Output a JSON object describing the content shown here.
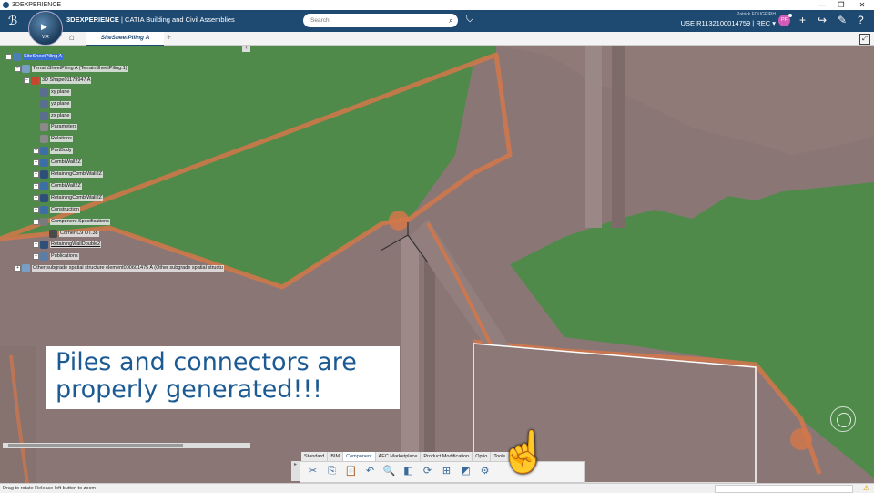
{
  "window": {
    "title": "3DEXPERIENCE",
    "controls": [
      "—",
      "❐",
      "✕"
    ]
  },
  "topbar": {
    "brand_bold": "3DEXPERIENCE",
    "brand_rest": " | CATIA Building and Civil Assemblies",
    "search_placeholder": "Search",
    "user_name": "Patrick FOUGEIRH",
    "context": "USE R1132100014759 | REC ▾",
    "avatar_initials": "PF",
    "version": "V.R"
  },
  "tabs": {
    "active_tab": "SiteSheetPiling A",
    "add_label": "+"
  },
  "tree": {
    "collapse_label": "‹",
    "nodes": [
      {
        "label": "SiteSheetPiling A",
        "depth": 0,
        "exp": "−",
        "icon_color": "#4a7fb3",
        "selected": true
      },
      {
        "label": "TerrainSheetPiling A (TerrainSheetPiling.1)",
        "depth": 1,
        "exp": "−",
        "icon_color": "#7a9fc4"
      },
      {
        "label": "3D Shape01179947 A",
        "depth": 2,
        "exp": "−",
        "icon_color": "#c8452e"
      },
      {
        "label": "xy plane",
        "depth": 3,
        "exp": "",
        "icon_color": "#5a6e90"
      },
      {
        "label": "yz plane",
        "depth": 3,
        "exp": "",
        "icon_color": "#5a6e90"
      },
      {
        "label": "zx plane",
        "depth": 3,
        "exp": "",
        "icon_color": "#5a6e90"
      },
      {
        "label": "Parameters",
        "depth": 3,
        "exp": "",
        "icon_color": "#8a8a8a"
      },
      {
        "label": "Relations",
        "depth": 3,
        "exp": "",
        "icon_color": "#8a8a8a"
      },
      {
        "label": "PartBody",
        "depth": 3,
        "exp": "+",
        "icon_color": "#3d6ea6"
      },
      {
        "label": "CombiWall2Z",
        "depth": 3,
        "exp": "+",
        "icon_color": "#3d6ea6"
      },
      {
        "label": "RetainingCombiWall2Z",
        "depth": 3,
        "exp": "+",
        "icon_color": "#2d4f7a"
      },
      {
        "label": "CombiWall2Z",
        "depth": 3,
        "exp": "+",
        "icon_color": "#3d6ea6"
      },
      {
        "label": "RetainingCombiWall2Z",
        "depth": 3,
        "exp": "+",
        "icon_color": "#2d4f7a"
      },
      {
        "label": "Construction",
        "depth": 3,
        "exp": "+",
        "icon_color": "#3d6ea6"
      },
      {
        "label": "Component Specifications",
        "depth": 3,
        "exp": "−",
        "icon_color": "#7a7a7a"
      },
      {
        "label": "Corner C9 OT.38",
        "depth": 4,
        "exp": "",
        "icon_color": "#4a4a4a"
      },
      {
        "label": "RetainingWallDouble2",
        "depth": 3,
        "exp": "+",
        "icon_color": "#2d4f7a",
        "underline": true
      },
      {
        "label": "Publications",
        "depth": 3,
        "exp": "+",
        "icon_color": "#5a7ea6"
      },
      {
        "label": "Other subgrade spatial structure element000601475 A (Other subgrade spatial structu",
        "depth": 1,
        "exp": "+",
        "icon_color": "#7a9fc4"
      }
    ]
  },
  "caption": {
    "line1": "Piles and connectors are",
    "line2": "properly generated!!!"
  },
  "action_bar": {
    "tabs": [
      "Standard",
      "BIM",
      "Component",
      "AEC Marketplace",
      "Product Modification",
      "Optio",
      "Tools",
      "Touch"
    ],
    "active_tab": "Component",
    "tools": [
      {
        "name": "cut-icon",
        "glyph": "✂"
      },
      {
        "name": "copy-icon",
        "glyph": "⎘"
      },
      {
        "name": "paste-icon",
        "glyph": "📋"
      },
      {
        "name": "undo-icon",
        "glyph": "↶"
      },
      {
        "name": "zoom-icon",
        "glyph": "🔍"
      },
      {
        "name": "view-icon",
        "glyph": "◧"
      },
      {
        "name": "refresh-icon",
        "glyph": "⟳"
      },
      {
        "name": "tree-icon",
        "glyph": "⊞"
      },
      {
        "name": "cube-icon",
        "glyph": "◩"
      },
      {
        "name": "settings-icon",
        "glyph": "⚙"
      }
    ]
  },
  "status": {
    "text": "Drag to rotate  Release left button to zoom"
  },
  "colors": {
    "ground": "#4f8a4a",
    "structure": "#8a7775",
    "edge": "#d4774a",
    "brand": "#1e4a72"
  }
}
